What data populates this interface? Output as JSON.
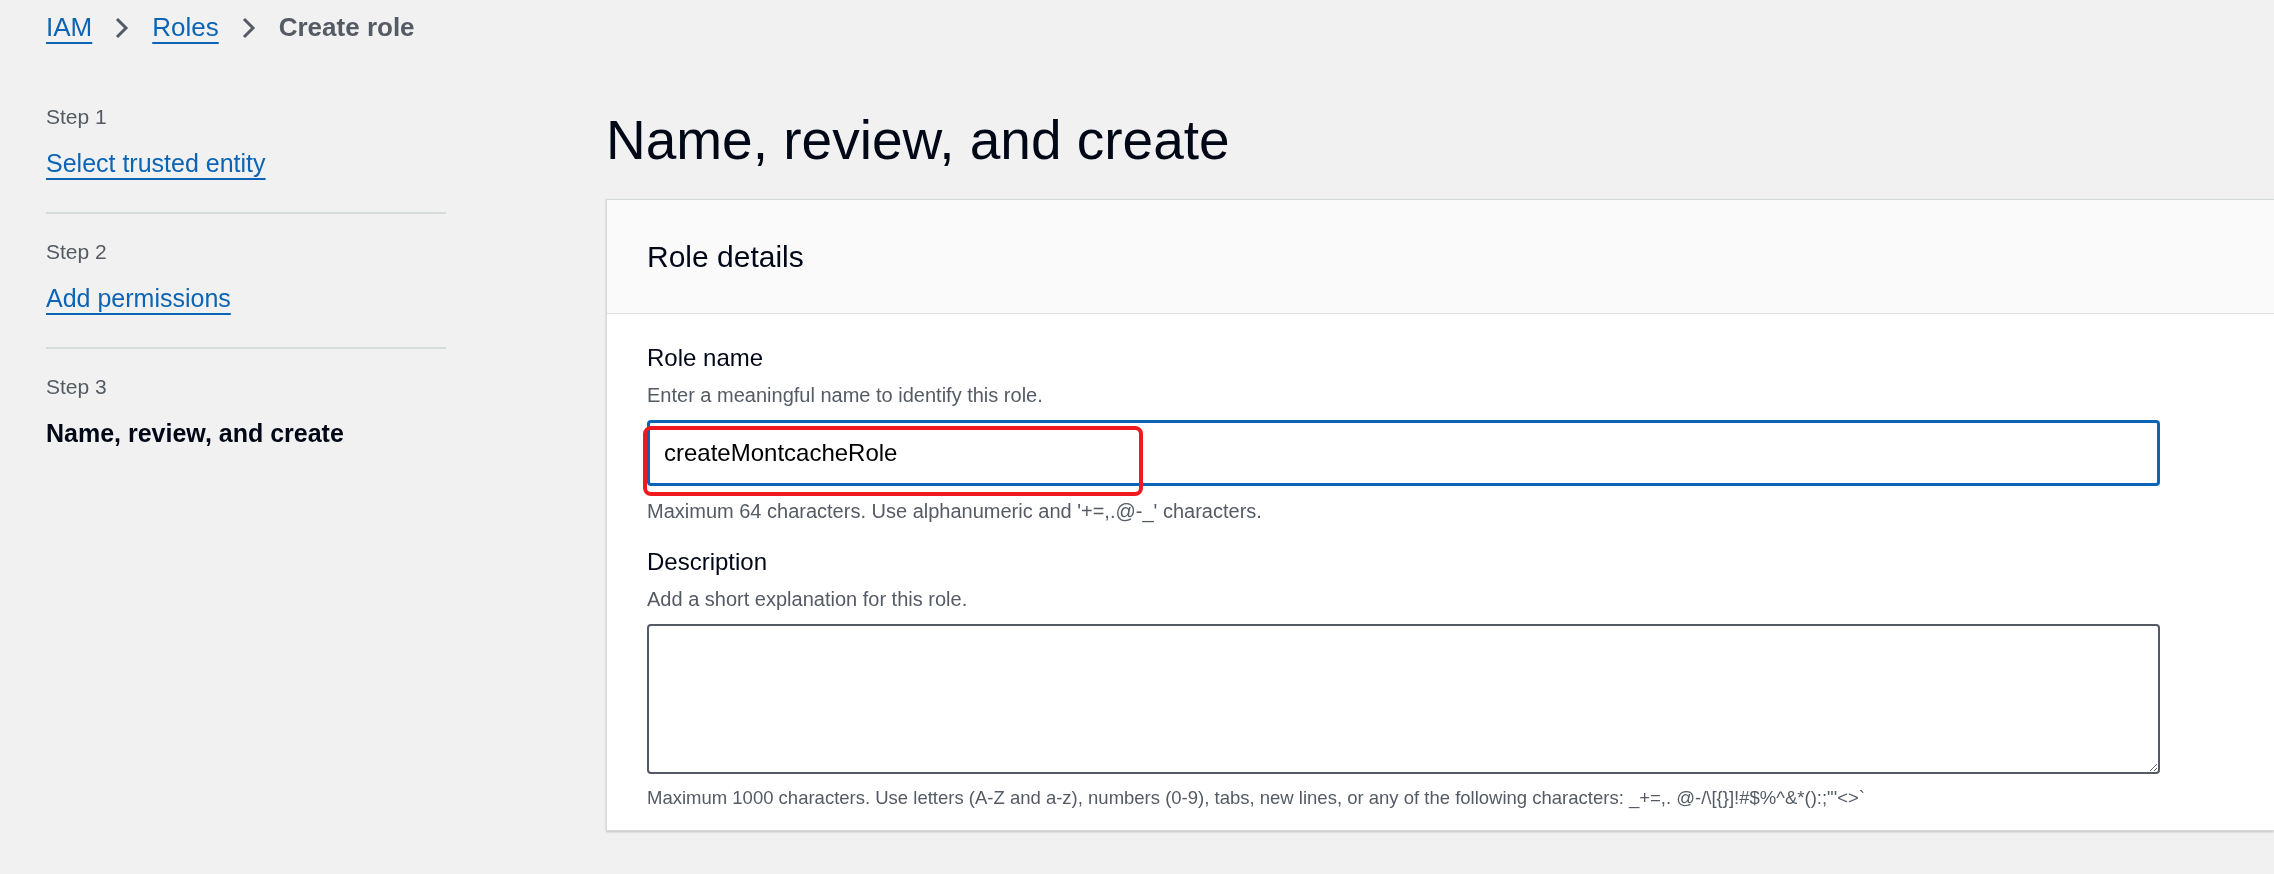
{
  "breadcrumb": [
    {
      "label": "IAM",
      "kind": "link"
    },
    {
      "label": "Roles",
      "kind": "link"
    },
    {
      "label": "Create role",
      "kind": "current"
    }
  ],
  "steps": [
    {
      "step": "Step 1",
      "title": "Select trusted entity",
      "selected": false
    },
    {
      "step": "Step 2",
      "title": "Add permissions",
      "selected": false
    },
    {
      "step": "Step 3",
      "title": "Name, review, and create",
      "selected": true
    }
  ],
  "page_title": "Name, review, and create",
  "card": {
    "title": "Role details",
    "fields": [
      {
        "kind": "input",
        "label": "Role name",
        "hint": "Enter a meaningful name to identify this role.",
        "value": "createMontcacheRole",
        "highlighted": true,
        "constraint": "Maximum 64 characters. Use alphanumeric and '+=,.@-_' characters."
      },
      {
        "kind": "textarea",
        "label": "Description",
        "hint": "Add a short explanation for this role.",
        "highlighted": false,
        "constraint": "Maximum 1000 characters. Use letters (A-Z and a-z), numbers (0-9), tabs, new lines, or any of the following characters: _+=,. @-/\\[{}]!#$%^&*():;\"'<>`"
      }
    ]
  }
}
